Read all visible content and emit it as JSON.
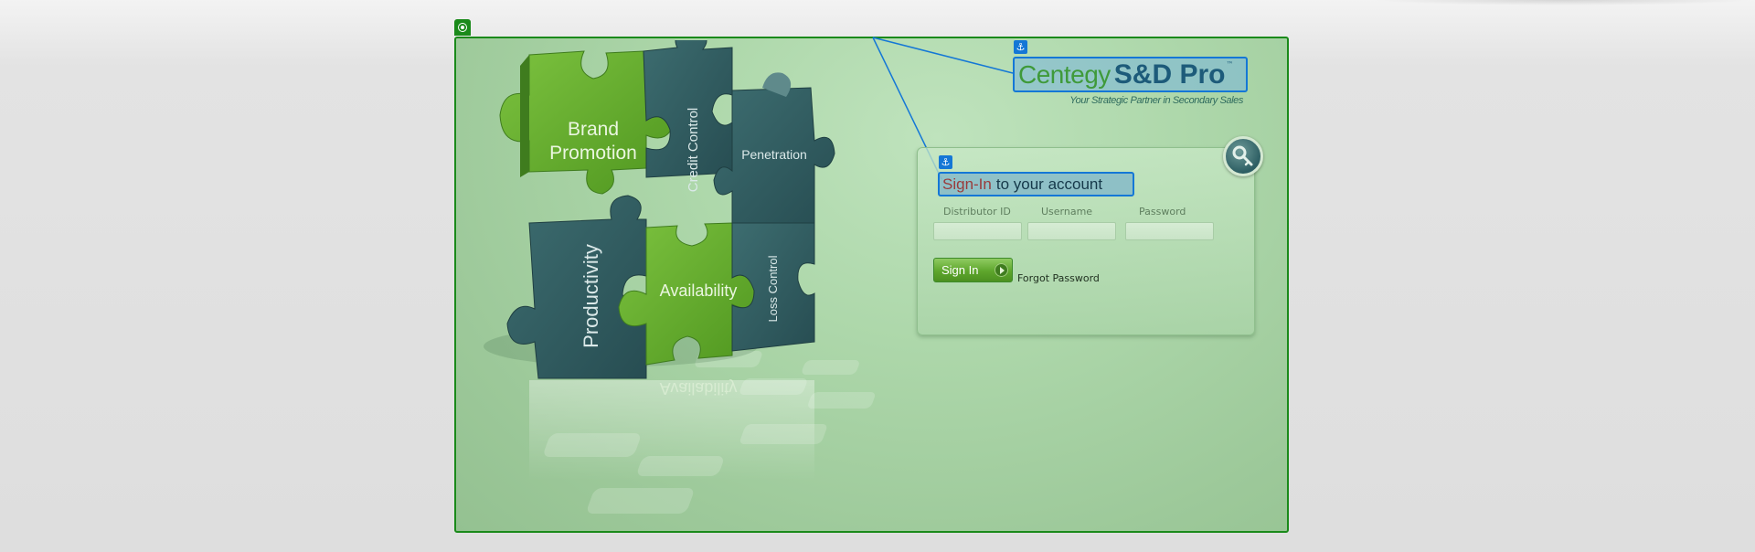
{
  "brand": {
    "name_part1": "Centegy",
    "name_part2": "S&D Pro",
    "trademark": "™",
    "tagline": "Your Strategic Partner in Secondary Sales"
  },
  "login": {
    "heading_highlight": "Sign-In",
    "heading_rest": "to your account",
    "fields": [
      {
        "label": "Distributor ID",
        "value": ""
      },
      {
        "label": "Username",
        "value": ""
      },
      {
        "label": "Password",
        "value": ""
      }
    ],
    "sign_in_button": "Sign In",
    "forgot_password": "Forgot Password"
  },
  "puzzle": {
    "pieces": [
      "Brand",
      "Promotion",
      "Credit Control",
      "Penetration",
      "Productivity",
      "Availability",
      "Loss Control"
    ]
  },
  "icons": {
    "frame_handle": "target-icon",
    "anchor": "anchor-icon",
    "key": "key-icon",
    "button_arrow": "play-arrow-icon"
  },
  "colors": {
    "frame_border": "#1a8a1a",
    "selection_blue": "#1477d6",
    "brand_green": "#3f9a3a",
    "brand_blue": "#1d5b7a",
    "piece_green": "#5ea62c",
    "piece_teal": "#2f5a5e"
  }
}
